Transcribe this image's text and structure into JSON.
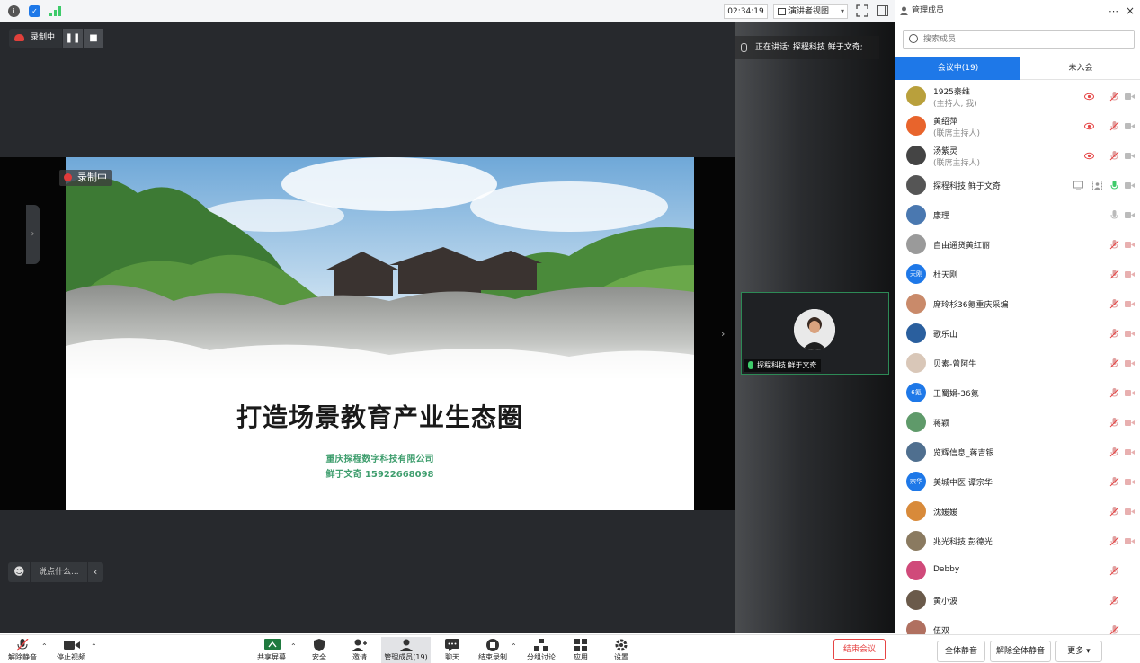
{
  "window": {
    "timer": "02:34:19",
    "view_mode": "演讲者视图"
  },
  "recording": {
    "label": "录制中",
    "badge": "录制中"
  },
  "slide": {
    "title": "打造场景教育产业生态圈",
    "company": "重庆探程数字科技有限公司",
    "contact": "鲜于文奇 15922668098"
  },
  "chat": {
    "placeholder": "说点什么..."
  },
  "speaking": {
    "text": "正在讲话: 探程科技 鲜于文奇;"
  },
  "video_tile": {
    "name": "探程科技 鲜于文奇"
  },
  "panel": {
    "title": "管理成员",
    "search_placeholder": "搜索成员",
    "tab_in_meeting": "会议中(19)",
    "tab_not_joined": "未入会",
    "members": [
      {
        "name": "1925秦维",
        "role": "(主持人, 我)",
        "avatar_color": "#b9a03c",
        "avatar_text": ""
      },
      {
        "name": "黄绍萍",
        "role": "(联席主持人)",
        "avatar_color": "#e8642c",
        "avatar_text": ""
      },
      {
        "name": "汤紫灵",
        "role": "(联席主持人)",
        "avatar_color": "#444444",
        "avatar_text": ""
      },
      {
        "name": "探程科技 鲜于文奇",
        "role": "",
        "avatar_color": "#555555",
        "avatar_text": ""
      },
      {
        "name": "康理",
        "role": "",
        "avatar_color": "#4a78b0",
        "avatar_text": ""
      },
      {
        "name": "自由通货黄红丽",
        "role": "",
        "avatar_color": "#9a9a9a",
        "avatar_text": ""
      },
      {
        "name": "杜天刚",
        "role": "",
        "avatar_color": "#1e78e8",
        "avatar_text": "天刚"
      },
      {
        "name": "席玲杉36氪重庆采编",
        "role": "",
        "avatar_color": "#c98a6a",
        "avatar_text": ""
      },
      {
        "name": "歌乐山",
        "role": "",
        "avatar_color": "#2a5f9e",
        "avatar_text": ""
      },
      {
        "name": "贝素-曾阿牛",
        "role": "",
        "avatar_color": "#d9c7b8",
        "avatar_text": ""
      },
      {
        "name": "王蜀娟-36氪",
        "role": "",
        "avatar_color": "#1e78e8",
        "avatar_text": "6氪"
      },
      {
        "name": "蒋颖",
        "role": "",
        "avatar_color": "#5f9a6a",
        "avatar_text": ""
      },
      {
        "name": "览辉信息_蒋吉银",
        "role": "",
        "avatar_color": "#4f6f8f",
        "avatar_text": ""
      },
      {
        "name": "美城中医 谭宗华",
        "role": "",
        "avatar_color": "#1e78e8",
        "avatar_text": "宗华"
      },
      {
        "name": "沈媛媛",
        "role": "",
        "avatar_color": "#d88a3a",
        "avatar_text": ""
      },
      {
        "name": "兆光科技 彭德光",
        "role": "",
        "avatar_color": "#8a7a60",
        "avatar_text": ""
      },
      {
        "name": "Debby",
        "role": "",
        "avatar_color": "#d04a7a",
        "avatar_text": ""
      },
      {
        "name": "黄小波",
        "role": "",
        "avatar_color": "#6a5a4a",
        "avatar_text": ""
      },
      {
        "name": "伍双",
        "role": "",
        "avatar_color": "#b07060",
        "avatar_text": ""
      }
    ]
  },
  "toolbar": {
    "unmute": "解除静音",
    "stop_video": "停止视频",
    "share_screen": "共享屏幕",
    "security": "安全",
    "invite": "邀请",
    "manage_members": "管理成员(19)",
    "chat": "聊天",
    "end_recording": "结束录制",
    "breakout": "分组讨论",
    "apps": "应用",
    "settings": "设置",
    "end_meeting": "结束会议",
    "mute_all": "全体静音",
    "unmute_all": "解除全体静音",
    "more": "更多"
  },
  "colors": {
    "accent": "#1e78e8",
    "danger": "#e64545",
    "slide_green": "#3f9e6e"
  }
}
